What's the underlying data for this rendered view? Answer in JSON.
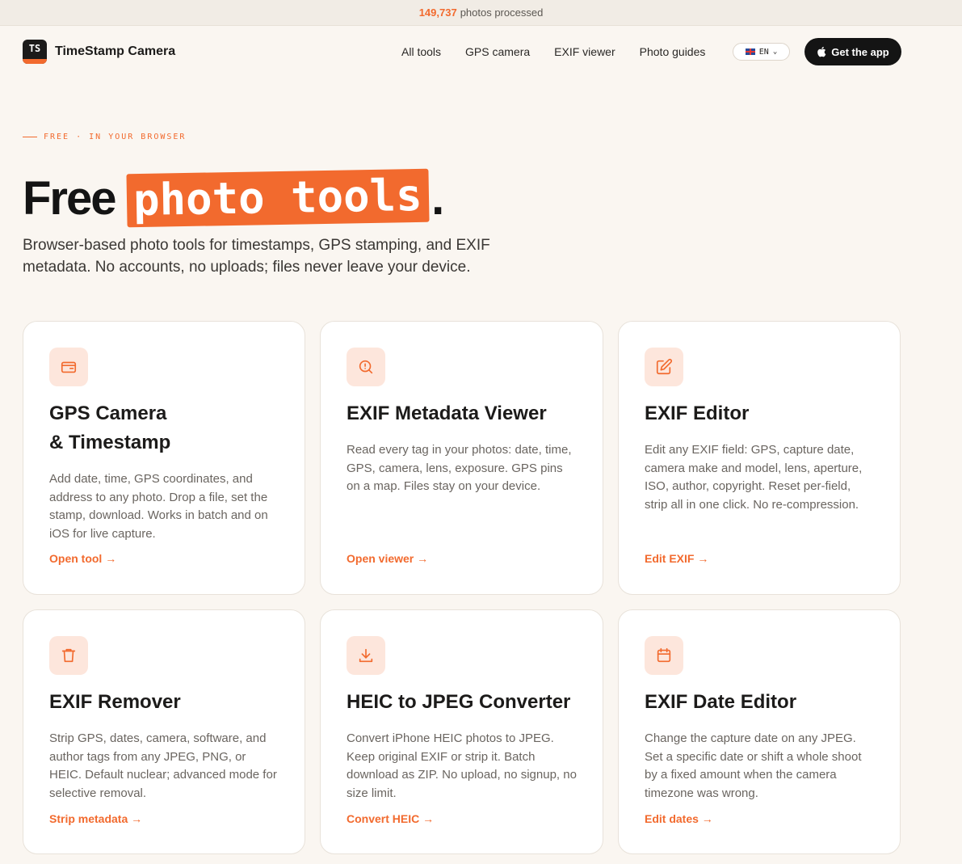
{
  "topbar": {
    "count": "149,737",
    "text": "photos processed"
  },
  "brand": {
    "logo_text": "TS",
    "name": "TimeStamp Camera"
  },
  "nav": {
    "links": [
      "All tools",
      "GPS camera",
      "EXIF viewer",
      "Photo guides"
    ],
    "lang": "EN",
    "cta": "Get the app"
  },
  "hero": {
    "eyebrow": "FREE · IN YOUR BROWSER",
    "title_pre": "Free",
    "title_highlight": "photo tools",
    "title_post": ".",
    "subtitle": "Browser-based photo tools for timestamps, GPS stamping, and EXIF metadata. No accounts, no uploads; files never leave your device."
  },
  "cards": [
    {
      "icon": "gps-card-icon",
      "title_line1": "GPS Camera",
      "title_line2": "& Timestamp",
      "description": "Add date, time, GPS coordinates, and address to any photo. Drop a file, set the stamp, download. Works in batch and on iOS for live capture.",
      "cta": "Open tool →"
    },
    {
      "icon": "search-icon",
      "title_line1": "EXIF Metadata Viewer",
      "description": "Read every tag in your photos: date, time, GPS, camera, lens, exposure. GPS pins on a map. Files stay on your device.",
      "cta": "Open viewer →"
    },
    {
      "icon": "edit-icon",
      "title_line1": "EXIF Editor",
      "description": "Edit any EXIF field: GPS, capture date, camera make and model, lens, aperture, ISO, author, copyright. Reset per-field, strip all in one click. No re-compression.",
      "cta": "Edit EXIF →"
    },
    {
      "icon": "trash-icon",
      "title_line1": "EXIF Remover",
      "description": "Strip GPS, dates, camera, software, and author tags from any JPEG, PNG, or HEIC. Default nuclear; advanced mode for selective removal.",
      "cta": "Strip metadata →"
    },
    {
      "icon": "download-icon",
      "title_line1": "HEIC to JPEG Converter",
      "description": "Convert iPhone HEIC photos to JPEG. Keep original EXIF or strip it. Batch download as ZIP. No upload, no signup, no size limit.",
      "cta": "Convert HEIC →"
    },
    {
      "icon": "calendar-icon",
      "title_line1": "EXIF Date Editor",
      "description": "Change the capture date on any JPEG. Set a specific date or shift a whole shoot by a fixed amount when the camera timezone was wrong.",
      "cta": "Edit dates →"
    }
  ],
  "colors": {
    "accent": "#f26a2e",
    "background": "#faf6f1",
    "icon_bg": "#fde6dc"
  }
}
